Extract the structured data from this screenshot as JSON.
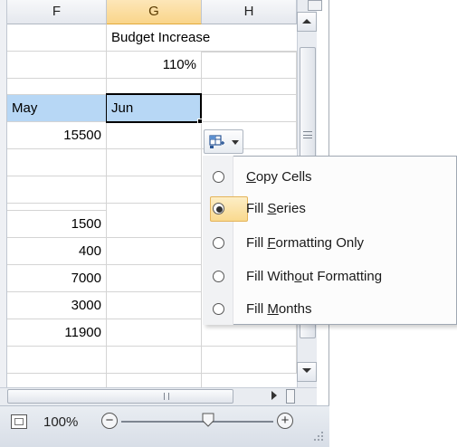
{
  "columns": [
    {
      "letter": "F",
      "selected": false
    },
    {
      "letter": "G",
      "selected": true
    },
    {
      "letter": "H",
      "selected": false
    }
  ],
  "cells": {
    "budget_increase_label": "Budget Increase",
    "budget_increase_value": "110%",
    "may_header": "May",
    "jun_header": "Jun",
    "f_values": [
      "15500",
      "",
      "",
      "1500",
      "400",
      "7000",
      "3000",
      "11900"
    ]
  },
  "status": {
    "zoom": "100%",
    "zoom_out": "−",
    "zoom_in": "+"
  },
  "autofill_menu": {
    "items": [
      {
        "pre": "",
        "ul": "C",
        "post": "opy Cells",
        "checked": false
      },
      {
        "pre": "Fill ",
        "ul": "S",
        "post": "eries",
        "checked": true
      },
      {
        "pre": "Fill ",
        "ul": "F",
        "post": "ormatting Only",
        "checked": false
      },
      {
        "pre": "Fill With",
        "ul": "o",
        "post": "ut Formatting",
        "checked": false
      },
      {
        "pre": "Fill ",
        "ul": "M",
        "post": "onths",
        "checked": false
      }
    ]
  },
  "colors": {
    "header_fill": "#b7d7f5",
    "selected_column": "#f9d58a",
    "menu_highlight": "#f9d98e"
  }
}
